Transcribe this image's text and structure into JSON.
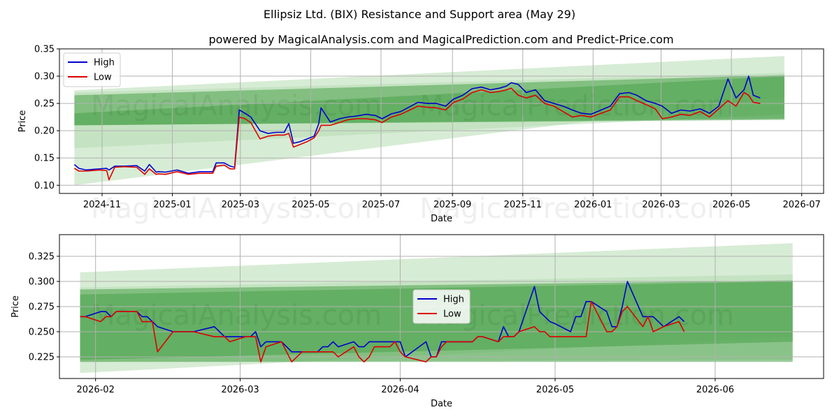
{
  "title": "Ellipsiz Ltd. (BIX) Resistance and Support area (May 29)",
  "subtitle": "powered by MagicalAnalysis.com and MagicalPrediction.com and Predict-Price.com",
  "watermarks": [
    "MagicalAnalysis.com",
    "MagicalPrediction.com"
  ],
  "colors": {
    "high": "#0000cc",
    "low": "#dd0000",
    "band_dark": "#4aa34a",
    "band_light": "#b7dcb3",
    "grid": "#b0b0b0"
  },
  "chart_data": [
    {
      "type": "line",
      "xlabel": "Date",
      "ylabel": "Price",
      "xlim": [
        "2024-09-25",
        "2026-07-20"
      ],
      "ylim": [
        0.085,
        0.35
      ],
      "yticks": [
        0.1,
        0.15,
        0.2,
        0.25,
        0.3,
        0.35
      ],
      "ytick_labels": [
        "0.10",
        "0.15",
        "0.20",
        "0.25",
        "0.30",
        "0.35"
      ],
      "xticks": [
        "2024-11-01",
        "2025-01-01",
        "2025-03-01",
        "2025-05-01",
        "2025-07-01",
        "2025-09-01",
        "2025-11-01",
        "2026-01-01",
        "2026-03-01",
        "2026-05-01",
        "2026-07-01"
      ],
      "xtick_labels": [
        "2024-11",
        "2025-01",
        "2025-03",
        "2025-05",
        "2025-07",
        "2025-09",
        "2025-11",
        "2026-01",
        "2026-03",
        "2026-05",
        "2026-07"
      ],
      "grid": true,
      "legend": "top-left",
      "bands": [
        {
          "x": [
            "2024-10-08",
            "2026-06-16"
          ],
          "upper": [
            0.274,
            0.337
          ],
          "lower": [
            0.1,
            0.262
          ],
          "shade": "light"
        },
        {
          "x": [
            "2024-10-08",
            "2026-06-16"
          ],
          "upper": [
            0.27,
            0.306
          ],
          "lower": [
            0.168,
            0.23
          ],
          "shade": "light"
        },
        {
          "x": [
            "2024-10-08",
            "2026-06-16"
          ],
          "upper": [
            0.265,
            0.302
          ],
          "lower": [
            0.21,
            0.222
          ],
          "shade": "dark"
        },
        {
          "x": [
            "2024-10-08",
            "2026-06-16"
          ],
          "upper": [
            0.232,
            0.3
          ],
          "lower": [
            0.21,
            0.22
          ],
          "shade": "dark"
        }
      ],
      "series": [
        {
          "name": "High",
          "x": [
            "2024-10-08",
            "2024-10-12",
            "2024-10-18",
            "2024-10-24",
            "2024-10-30",
            "2024-11-05",
            "2024-11-07",
            "2024-11-12",
            "2024-11-20",
            "2024-12-01",
            "2024-12-08",
            "2024-12-12",
            "2024-12-18",
            "2024-12-20",
            "2024-12-26",
            "2025-01-05",
            "2025-01-15",
            "2025-01-25",
            "2025-02-05",
            "2025-02-08",
            "2025-02-15",
            "2025-02-20",
            "2025-02-24",
            "2025-02-28",
            "2025-03-05",
            "2025-03-10",
            "2025-03-18",
            "2025-03-25",
            "2025-04-01",
            "2025-04-08",
            "2025-04-12",
            "2025-04-16",
            "2025-04-22",
            "2025-04-28",
            "2025-05-04",
            "2025-05-08",
            "2025-05-10",
            "2025-05-18",
            "2025-05-26",
            "2025-06-02",
            "2025-06-10",
            "2025-06-18",
            "2025-06-26",
            "2025-07-02",
            "2025-07-10",
            "2025-07-18",
            "2025-07-26",
            "2025-08-02",
            "2025-08-10",
            "2025-08-18",
            "2025-08-26",
            "2025-09-02",
            "2025-09-10",
            "2025-09-18",
            "2025-09-26",
            "2025-10-04",
            "2025-10-12",
            "2025-10-18",
            "2025-10-22",
            "2025-10-28",
            "2025-11-04",
            "2025-11-12",
            "2025-11-20",
            "2025-11-28",
            "2025-12-06",
            "2025-12-14",
            "2025-12-22",
            "2025-12-30",
            "2026-01-08",
            "2026-01-16",
            "2026-01-24",
            "2026-02-01",
            "2026-02-08",
            "2026-02-16",
            "2026-02-24",
            "2026-03-02",
            "2026-03-10",
            "2026-03-18",
            "2026-03-26",
            "2026-04-04",
            "2026-04-12",
            "2026-04-20",
            "2026-04-28",
            "2026-05-05",
            "2026-05-12",
            "2026-05-16",
            "2026-05-20",
            "2026-05-26"
          ],
          "values": [
            0.138,
            0.131,
            0.128,
            0.129,
            0.13,
            0.131,
            0.128,
            0.135,
            0.135,
            0.136,
            0.126,
            0.138,
            0.124,
            0.125,
            0.124,
            0.128,
            0.122,
            0.125,
            0.125,
            0.141,
            0.141,
            0.135,
            0.133,
            0.238,
            0.232,
            0.225,
            0.2,
            0.195,
            0.197,
            0.197,
            0.213,
            0.177,
            0.18,
            0.185,
            0.19,
            0.213,
            0.242,
            0.216,
            0.222,
            0.225,
            0.227,
            0.23,
            0.228,
            0.222,
            0.231,
            0.235,
            0.244,
            0.252,
            0.25,
            0.25,
            0.245,
            0.258,
            0.265,
            0.277,
            0.28,
            0.275,
            0.278,
            0.282,
            0.288,
            0.285,
            0.27,
            0.275,
            0.255,
            0.25,
            0.245,
            0.238,
            0.232,
            0.23,
            0.238,
            0.245,
            0.268,
            0.27,
            0.265,
            0.255,
            0.25,
            0.245,
            0.232,
            0.238,
            0.236,
            0.24,
            0.232,
            0.245,
            0.295,
            0.26,
            0.275,
            0.3,
            0.265,
            0.26
          ]
        },
        {
          "name": "Low",
          "x": [
            "2024-10-08",
            "2024-10-12",
            "2024-10-18",
            "2024-10-24",
            "2024-10-30",
            "2024-11-05",
            "2024-11-07",
            "2024-11-12",
            "2024-11-20",
            "2024-12-01",
            "2024-12-08",
            "2024-12-12",
            "2024-12-18",
            "2024-12-20",
            "2024-12-26",
            "2025-01-05",
            "2025-01-15",
            "2025-01-25",
            "2025-02-05",
            "2025-02-08",
            "2025-02-15",
            "2025-02-20",
            "2025-02-24",
            "2025-02-28",
            "2025-03-05",
            "2025-03-10",
            "2025-03-18",
            "2025-03-25",
            "2025-04-01",
            "2025-04-08",
            "2025-04-12",
            "2025-04-16",
            "2025-04-22",
            "2025-04-28",
            "2025-05-04",
            "2025-05-08",
            "2025-05-10",
            "2025-05-18",
            "2025-05-26",
            "2025-06-02",
            "2025-06-10",
            "2025-06-18",
            "2025-06-26",
            "2025-07-02",
            "2025-07-10",
            "2025-07-18",
            "2025-07-26",
            "2025-08-02",
            "2025-08-10",
            "2025-08-18",
            "2025-08-26",
            "2025-09-02",
            "2025-09-10",
            "2025-09-18",
            "2025-09-26",
            "2025-10-04",
            "2025-10-12",
            "2025-10-18",
            "2025-10-22",
            "2025-10-28",
            "2025-11-04",
            "2025-11-12",
            "2025-11-20",
            "2025-11-28",
            "2025-12-06",
            "2025-12-14",
            "2025-12-22",
            "2025-12-30",
            "2026-01-08",
            "2026-01-16",
            "2026-01-24",
            "2026-02-01",
            "2026-02-08",
            "2026-02-16",
            "2026-02-24",
            "2026-03-02",
            "2026-03-10",
            "2026-03-18",
            "2026-03-26",
            "2026-04-04",
            "2026-04-12",
            "2026-04-20",
            "2026-04-28",
            "2026-05-05",
            "2026-05-12",
            "2026-05-16",
            "2026-05-20",
            "2026-05-26"
          ],
          "values": [
            0.131,
            0.126,
            0.126,
            0.127,
            0.128,
            0.127,
            0.11,
            0.133,
            0.134,
            0.133,
            0.12,
            0.13,
            0.12,
            0.121,
            0.12,
            0.125,
            0.12,
            0.122,
            0.122,
            0.135,
            0.137,
            0.13,
            0.13,
            0.225,
            0.222,
            0.215,
            0.185,
            0.19,
            0.192,
            0.192,
            0.195,
            0.17,
            0.175,
            0.18,
            0.187,
            0.2,
            0.21,
            0.21,
            0.215,
            0.22,
            0.222,
            0.222,
            0.22,
            0.215,
            0.225,
            0.23,
            0.238,
            0.245,
            0.243,
            0.242,
            0.238,
            0.252,
            0.258,
            0.27,
            0.275,
            0.27,
            0.272,
            0.275,
            0.278,
            0.265,
            0.26,
            0.265,
            0.25,
            0.245,
            0.235,
            0.225,
            0.228,
            0.225,
            0.232,
            0.238,
            0.262,
            0.262,
            0.255,
            0.248,
            0.24,
            0.222,
            0.225,
            0.23,
            0.228,
            0.235,
            0.225,
            0.24,
            0.255,
            0.245,
            0.27,
            0.265,
            0.252,
            0.25
          ]
        }
      ]
    },
    {
      "type": "line",
      "xlabel": "Date",
      "ylabel": "Price",
      "xlim": [
        "2026-01-25",
        "2026-06-22"
      ],
      "ylim": [
        0.2035,
        0.3465
      ],
      "yticks": [
        0.225,
        0.25,
        0.275,
        0.3,
        0.325
      ],
      "ytick_labels": [
        "0.225",
        "0.250",
        "0.275",
        "0.300",
        "0.325"
      ],
      "xticks": [
        "2026-02-01",
        "2026-03-01",
        "2026-04-01",
        "2026-05-01",
        "2026-06-01"
      ],
      "xtick_labels": [
        "2026-02",
        "2026-03",
        "2026-04",
        "2026-05",
        "2026-06"
      ],
      "grid": true,
      "legend": "center",
      "bands": [
        {
          "x": [
            "2026-01-29",
            "2026-06-16"
          ],
          "upper": [
            0.309,
            0.338
          ],
          "lower": [
            0.209,
            0.245
          ],
          "shade": "light"
        },
        {
          "x": [
            "2026-01-29",
            "2026-06-16"
          ],
          "upper": [
            0.294,
            0.307
          ],
          "lower": [
            0.22,
            0.222
          ],
          "shade": "light"
        },
        {
          "x": [
            "2026-01-29",
            "2026-06-16"
          ],
          "upper": [
            0.292,
            0.301
          ],
          "lower": [
            0.22,
            0.22
          ],
          "shade": "dark"
        },
        {
          "x": [
            "2026-01-29",
            "2026-06-16"
          ],
          "upper": [
            0.287,
            0.3
          ],
          "lower": [
            0.222,
            0.24
          ],
          "shade": "dark"
        }
      ],
      "series": [
        {
          "name": "High",
          "x": [
            "2026-01-29",
            "2026-01-30",
            "2026-02-02",
            "2026-02-03",
            "2026-02-04",
            "2026-02-05",
            "2026-02-06",
            "2026-02-09",
            "2026-02-10",
            "2026-02-11",
            "2026-02-12",
            "2026-02-13",
            "2026-02-16",
            "2026-02-20",
            "2026-02-24",
            "2026-02-26",
            "2026-02-27",
            "2026-03-02",
            "2026-03-03",
            "2026-03-04",
            "2026-03-05",
            "2026-03-06",
            "2026-03-09",
            "2026-03-10",
            "2026-03-11",
            "2026-03-13",
            "2026-03-16",
            "2026-03-17",
            "2026-03-18",
            "2026-03-19",
            "2026-03-20",
            "2026-03-23",
            "2026-03-24",
            "2026-03-25",
            "2026-03-26",
            "2026-03-27",
            "2026-03-30",
            "2026-03-31",
            "2026-04-01",
            "2026-04-02",
            "2026-04-06",
            "2026-04-07",
            "2026-04-08",
            "2026-04-09",
            "2026-04-10",
            "2026-04-13",
            "2026-04-14",
            "2026-04-15",
            "2026-04-16",
            "2026-04-17",
            "2026-04-20",
            "2026-04-21",
            "2026-04-22",
            "2026-04-23",
            "2026-04-24",
            "2026-04-27",
            "2026-04-28",
            "2026-04-29",
            "2026-04-30",
            "2026-05-01",
            "2026-05-04",
            "2026-05-05",
            "2026-05-06",
            "2026-05-07",
            "2026-05-08",
            "2026-05-11",
            "2026-05-12",
            "2026-05-13",
            "2026-05-14",
            "2026-05-15",
            "2026-05-18",
            "2026-05-19",
            "2026-05-20",
            "2026-05-22",
            "2026-05-25",
            "2026-05-26"
          ],
          "values": [
            0.265,
            0.265,
            0.27,
            0.27,
            0.265,
            0.27,
            0.27,
            0.27,
            0.265,
            0.265,
            0.26,
            0.255,
            0.25,
            0.25,
            0.255,
            0.245,
            0.245,
            0.245,
            0.245,
            0.25,
            0.235,
            0.24,
            0.24,
            0.235,
            0.23,
            0.23,
            0.23,
            0.235,
            0.235,
            0.24,
            0.235,
            0.24,
            0.235,
            0.235,
            0.24,
            0.24,
            0.24,
            0.24,
            0.24,
            0.225,
            0.24,
            0.225,
            0.225,
            0.24,
            0.24,
            0.24,
            0.24,
            0.24,
            0.245,
            0.245,
            0.24,
            0.255,
            0.245,
            0.245,
            0.25,
            0.295,
            0.27,
            0.265,
            0.26,
            0.258,
            0.25,
            0.265,
            0.265,
            0.28,
            0.28,
            0.27,
            0.255,
            0.255,
            0.275,
            0.3,
            0.265,
            0.265,
            0.265,
            0.255,
            0.265,
            0.26
          ]
        },
        {
          "name": "Low",
          "x": [
            "2026-01-29",
            "2026-01-30",
            "2026-02-02",
            "2026-02-03",
            "2026-02-04",
            "2026-02-05",
            "2026-02-06",
            "2026-02-09",
            "2026-02-10",
            "2026-02-11",
            "2026-02-12",
            "2026-02-13",
            "2026-02-16",
            "2026-02-20",
            "2026-02-24",
            "2026-02-26",
            "2026-02-27",
            "2026-03-02",
            "2026-03-03",
            "2026-03-04",
            "2026-03-05",
            "2026-03-06",
            "2026-03-09",
            "2026-03-10",
            "2026-03-11",
            "2026-03-13",
            "2026-03-16",
            "2026-03-17",
            "2026-03-18",
            "2026-03-19",
            "2026-03-20",
            "2026-03-23",
            "2026-03-24",
            "2026-03-25",
            "2026-03-26",
            "2026-03-27",
            "2026-03-30",
            "2026-03-31",
            "2026-04-01",
            "2026-04-02",
            "2026-04-06",
            "2026-04-07",
            "2026-04-08",
            "2026-04-09",
            "2026-04-10",
            "2026-04-13",
            "2026-04-14",
            "2026-04-15",
            "2026-04-16",
            "2026-04-17",
            "2026-04-20",
            "2026-04-21",
            "2026-04-22",
            "2026-04-23",
            "2026-04-24",
            "2026-04-27",
            "2026-04-28",
            "2026-04-29",
            "2026-04-30",
            "2026-05-01",
            "2026-05-04",
            "2026-05-05",
            "2026-05-06",
            "2026-05-07",
            "2026-05-08",
            "2026-05-11",
            "2026-05-12",
            "2026-05-13",
            "2026-05-14",
            "2026-05-15",
            "2026-05-18",
            "2026-05-19",
            "2026-05-20",
            "2026-05-22",
            "2026-05-25",
            "2026-05-26"
          ],
          "values": [
            0.265,
            0.265,
            0.26,
            0.265,
            0.265,
            0.27,
            0.27,
            0.27,
            0.26,
            0.26,
            0.26,
            0.23,
            0.25,
            0.25,
            0.245,
            0.245,
            0.24,
            0.245,
            0.245,
            0.245,
            0.22,
            0.235,
            0.24,
            0.23,
            0.22,
            0.23,
            0.23,
            0.23,
            0.23,
            0.23,
            0.225,
            0.235,
            0.225,
            0.22,
            0.225,
            0.235,
            0.235,
            0.24,
            0.23,
            0.225,
            0.22,
            0.225,
            0.225,
            0.235,
            0.24,
            0.24,
            0.24,
            0.24,
            0.245,
            0.245,
            0.24,
            0.245,
            0.245,
            0.245,
            0.25,
            0.255,
            0.25,
            0.25,
            0.245,
            0.245,
            0.245,
            0.245,
            0.245,
            0.245,
            0.28,
            0.25,
            0.25,
            0.255,
            0.27,
            0.275,
            0.255,
            0.265,
            0.25,
            0.255,
            0.26,
            0.25
          ]
        }
      ]
    }
  ]
}
